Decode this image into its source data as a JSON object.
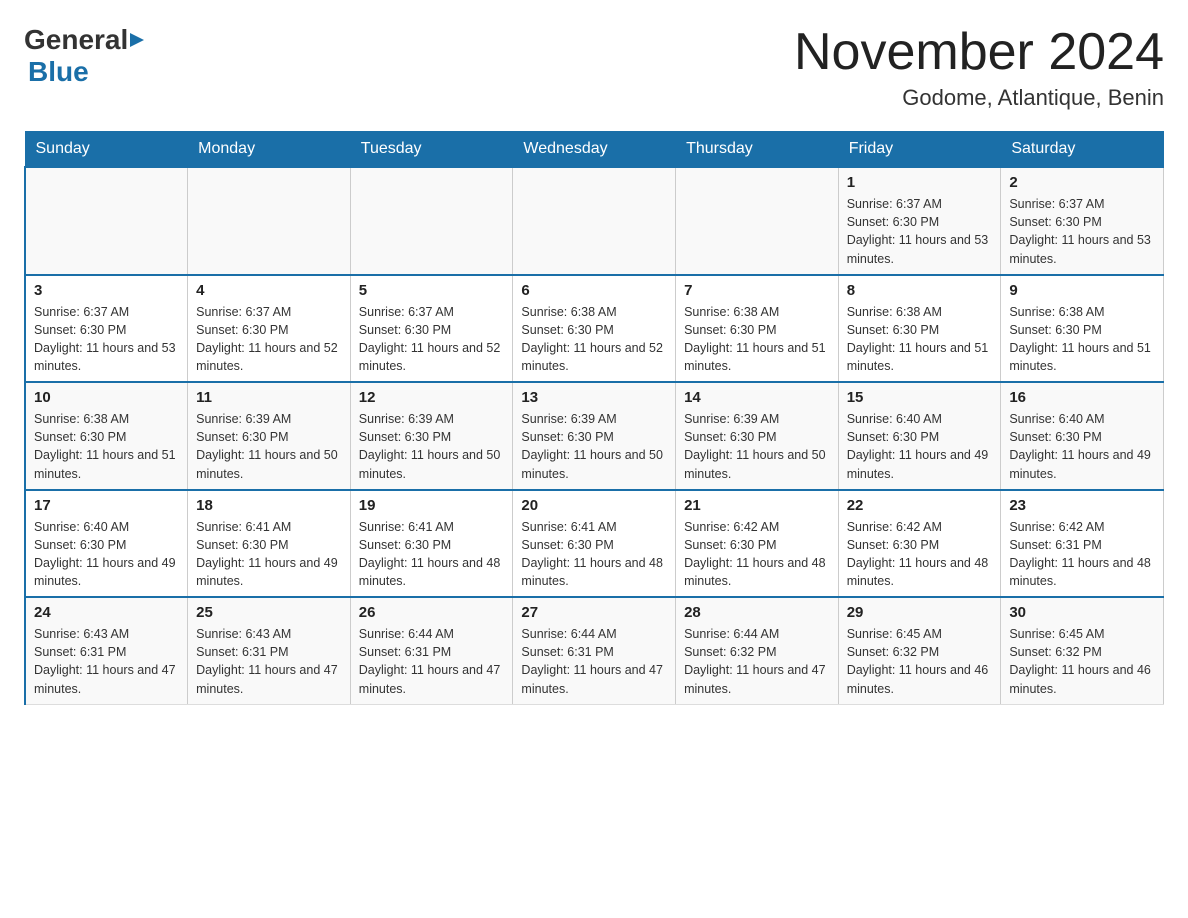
{
  "logo": {
    "general": "General",
    "blue": "Blue"
  },
  "title": "November 2024",
  "subtitle": "Godome, Atlantique, Benin",
  "days_of_week": [
    "Sunday",
    "Monday",
    "Tuesday",
    "Wednesday",
    "Thursday",
    "Friday",
    "Saturday"
  ],
  "weeks": [
    [
      {
        "day": "",
        "info": ""
      },
      {
        "day": "",
        "info": ""
      },
      {
        "day": "",
        "info": ""
      },
      {
        "day": "",
        "info": ""
      },
      {
        "day": "",
        "info": ""
      },
      {
        "day": "1",
        "info": "Sunrise: 6:37 AM\nSunset: 6:30 PM\nDaylight: 11 hours and 53 minutes."
      },
      {
        "day": "2",
        "info": "Sunrise: 6:37 AM\nSunset: 6:30 PM\nDaylight: 11 hours and 53 minutes."
      }
    ],
    [
      {
        "day": "3",
        "info": "Sunrise: 6:37 AM\nSunset: 6:30 PM\nDaylight: 11 hours and 53 minutes."
      },
      {
        "day": "4",
        "info": "Sunrise: 6:37 AM\nSunset: 6:30 PM\nDaylight: 11 hours and 52 minutes."
      },
      {
        "day": "5",
        "info": "Sunrise: 6:37 AM\nSunset: 6:30 PM\nDaylight: 11 hours and 52 minutes."
      },
      {
        "day": "6",
        "info": "Sunrise: 6:38 AM\nSunset: 6:30 PM\nDaylight: 11 hours and 52 minutes."
      },
      {
        "day": "7",
        "info": "Sunrise: 6:38 AM\nSunset: 6:30 PM\nDaylight: 11 hours and 51 minutes."
      },
      {
        "day": "8",
        "info": "Sunrise: 6:38 AM\nSunset: 6:30 PM\nDaylight: 11 hours and 51 minutes."
      },
      {
        "day": "9",
        "info": "Sunrise: 6:38 AM\nSunset: 6:30 PM\nDaylight: 11 hours and 51 minutes."
      }
    ],
    [
      {
        "day": "10",
        "info": "Sunrise: 6:38 AM\nSunset: 6:30 PM\nDaylight: 11 hours and 51 minutes."
      },
      {
        "day": "11",
        "info": "Sunrise: 6:39 AM\nSunset: 6:30 PM\nDaylight: 11 hours and 50 minutes."
      },
      {
        "day": "12",
        "info": "Sunrise: 6:39 AM\nSunset: 6:30 PM\nDaylight: 11 hours and 50 minutes."
      },
      {
        "day": "13",
        "info": "Sunrise: 6:39 AM\nSunset: 6:30 PM\nDaylight: 11 hours and 50 minutes."
      },
      {
        "day": "14",
        "info": "Sunrise: 6:39 AM\nSunset: 6:30 PM\nDaylight: 11 hours and 50 minutes."
      },
      {
        "day": "15",
        "info": "Sunrise: 6:40 AM\nSunset: 6:30 PM\nDaylight: 11 hours and 49 minutes."
      },
      {
        "day": "16",
        "info": "Sunrise: 6:40 AM\nSunset: 6:30 PM\nDaylight: 11 hours and 49 minutes."
      }
    ],
    [
      {
        "day": "17",
        "info": "Sunrise: 6:40 AM\nSunset: 6:30 PM\nDaylight: 11 hours and 49 minutes."
      },
      {
        "day": "18",
        "info": "Sunrise: 6:41 AM\nSunset: 6:30 PM\nDaylight: 11 hours and 49 minutes."
      },
      {
        "day": "19",
        "info": "Sunrise: 6:41 AM\nSunset: 6:30 PM\nDaylight: 11 hours and 48 minutes."
      },
      {
        "day": "20",
        "info": "Sunrise: 6:41 AM\nSunset: 6:30 PM\nDaylight: 11 hours and 48 minutes."
      },
      {
        "day": "21",
        "info": "Sunrise: 6:42 AM\nSunset: 6:30 PM\nDaylight: 11 hours and 48 minutes."
      },
      {
        "day": "22",
        "info": "Sunrise: 6:42 AM\nSunset: 6:30 PM\nDaylight: 11 hours and 48 minutes."
      },
      {
        "day": "23",
        "info": "Sunrise: 6:42 AM\nSunset: 6:31 PM\nDaylight: 11 hours and 48 minutes."
      }
    ],
    [
      {
        "day": "24",
        "info": "Sunrise: 6:43 AM\nSunset: 6:31 PM\nDaylight: 11 hours and 47 minutes."
      },
      {
        "day": "25",
        "info": "Sunrise: 6:43 AM\nSunset: 6:31 PM\nDaylight: 11 hours and 47 minutes."
      },
      {
        "day": "26",
        "info": "Sunrise: 6:44 AM\nSunset: 6:31 PM\nDaylight: 11 hours and 47 minutes."
      },
      {
        "day": "27",
        "info": "Sunrise: 6:44 AM\nSunset: 6:31 PM\nDaylight: 11 hours and 47 minutes."
      },
      {
        "day": "28",
        "info": "Sunrise: 6:44 AM\nSunset: 6:32 PM\nDaylight: 11 hours and 47 minutes."
      },
      {
        "day": "29",
        "info": "Sunrise: 6:45 AM\nSunset: 6:32 PM\nDaylight: 11 hours and 46 minutes."
      },
      {
        "day": "30",
        "info": "Sunrise: 6:45 AM\nSunset: 6:32 PM\nDaylight: 11 hours and 46 minutes."
      }
    ]
  ]
}
